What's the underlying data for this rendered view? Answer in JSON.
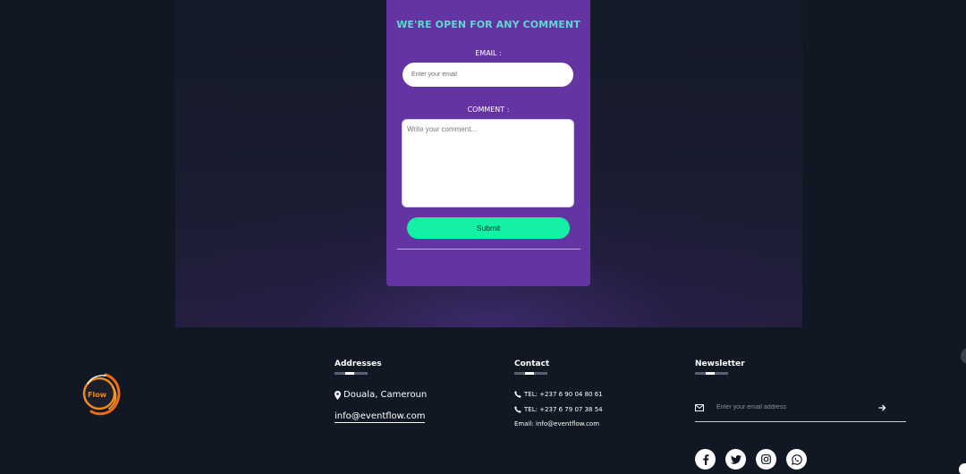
{
  "comment_form": {
    "title": "WE'RE OPEN FOR ANY COMMENT",
    "email_label": "EMAIL :",
    "email_placeholder": "Enter your email",
    "comment_label": "COMMENT :",
    "comment_placeholder": "Write your comment...",
    "submit_label": "Submit"
  },
  "footer": {
    "logo_text": "Flow",
    "addresses": {
      "title": "Addresses",
      "location": "Douala, Cameroun",
      "email": "info@eventflow.com"
    },
    "contact": {
      "title": "Contact",
      "phone1": "TEL: +237 6 90 04 80 61",
      "phone2": "TEL: +237 6 79 07 38 54",
      "email": "Email: info@eventflow.com"
    },
    "newsletter": {
      "title": "Newsletter",
      "placeholder": "Enter your email address"
    },
    "social_icons": [
      "facebook-icon",
      "twitter-icon",
      "instagram-icon",
      "whatsapp-icon"
    ]
  },
  "colors": {
    "background": "#111823",
    "card": "#6434a3",
    "title_accent": "#5fd9d0",
    "submit": "#14f0a6"
  }
}
